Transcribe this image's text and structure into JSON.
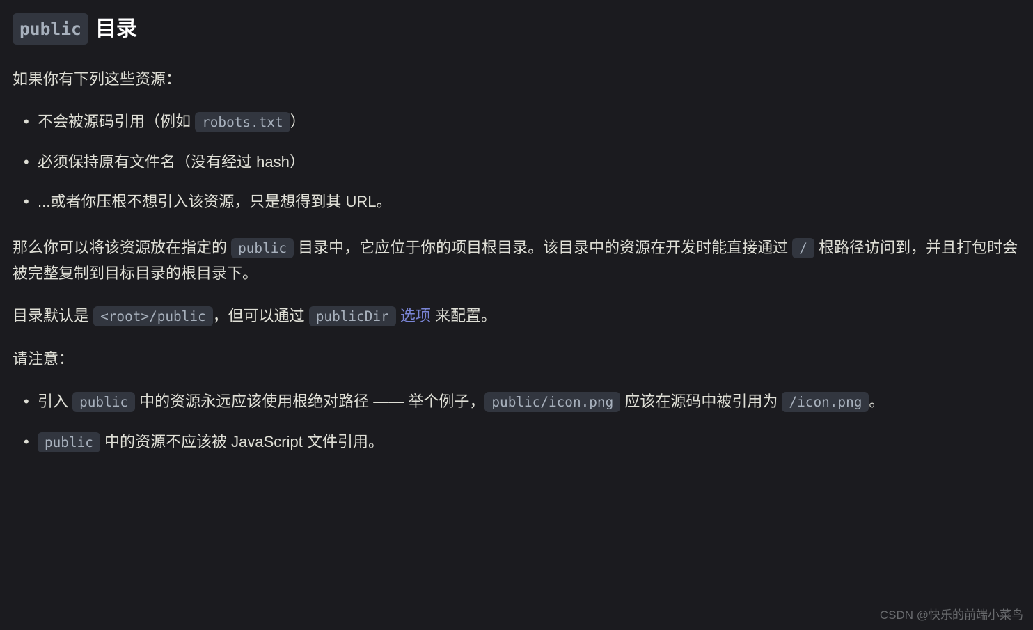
{
  "heading": {
    "code": "public",
    "text": "目录"
  },
  "intro": "如果你有下列这些资源：",
  "list1": {
    "item1": {
      "prefix": "不会被源码引用（例如 ",
      "code": "robots.txt",
      "suffix": "）"
    },
    "item2": "必须保持原有文件名（没有经过 hash）",
    "item3": "...或者你压根不想引入该资源，只是想得到其 URL。"
  },
  "para2": {
    "t1": "那么你可以将该资源放在指定的 ",
    "c1": "public",
    "t2": " 目录中，它应位于你的项目根目录。该目录中的资源在开发时能直接通过 ",
    "c2": "/",
    "t3": " 根路径访问到，并且打包时会被完整复制到目标目录的根目录下。"
  },
  "para3": {
    "t1": "目录默认是 ",
    "c1": "<root>/public",
    "t2": "，但可以通过 ",
    "c2": "publicDir",
    "t3": " ",
    "link": "选项",
    "t4": " 来配置。"
  },
  "para4": "请注意：",
  "list2": {
    "item1": {
      "t1": "引入 ",
      "c1": "public",
      "t2": " 中的资源永远应该使用根绝对路径 —— 举个例子，",
      "c2": "public/icon.png",
      "t3": " 应该在源码中被引用为 ",
      "c3": "/icon.png",
      "t4": "。"
    },
    "item2": {
      "c1": "public",
      "t1": " 中的资源不应该被 JavaScript 文件引用。"
    }
  },
  "watermark": "CSDN @快乐的前端小菜鸟"
}
